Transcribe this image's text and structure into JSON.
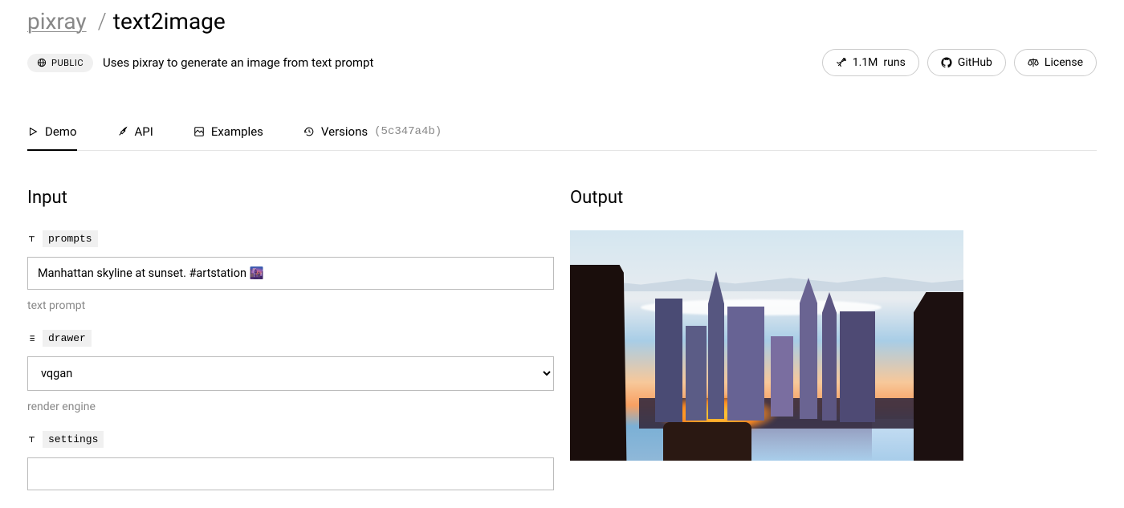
{
  "breadcrumb": {
    "owner": "pixray",
    "separator": "/",
    "name": "text2image"
  },
  "header": {
    "visibility_badge": "PUBLIC",
    "description": "Uses pixray to generate an image from text prompt",
    "runs": {
      "count": "1.1M",
      "suffix": "runs"
    },
    "github_label": "GitHub",
    "license_label": "License"
  },
  "tabs": {
    "demo": "Demo",
    "api": "API",
    "examples": "Examples",
    "versions": "Versions",
    "versions_hash": "(5c347a4b)"
  },
  "input": {
    "title": "Input",
    "prompts": {
      "name": "prompts",
      "value": "Manhattan skyline at sunset. #artstation 🌆",
      "hint": "text prompt"
    },
    "drawer": {
      "name": "drawer",
      "value": "vqgan",
      "hint": "render engine"
    },
    "settings": {
      "name": "settings"
    }
  },
  "output": {
    "title": "Output"
  }
}
